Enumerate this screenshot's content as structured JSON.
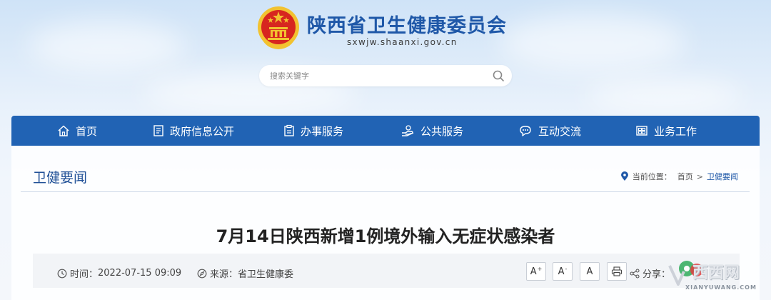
{
  "header": {
    "site_title": "陕西省卫生健康委员会",
    "site_url": "sxwjw.shaanxi.gov.cn",
    "search_placeholder": "搜索关键字"
  },
  "nav": {
    "items": [
      {
        "label": "首页",
        "icon": "home-icon"
      },
      {
        "label": "政府信息公开",
        "icon": "document-list-icon"
      },
      {
        "label": "办事服务",
        "icon": "clipboard-icon"
      },
      {
        "label": "公共服务",
        "icon": "hand-service-icon"
      },
      {
        "label": "互动交流",
        "icon": "chat-bubble-icon"
      },
      {
        "label": "业务工作",
        "icon": "briefcase-icon"
      }
    ]
  },
  "section": {
    "title": "卫健要闻",
    "location_label": "当前位置：",
    "crumbs": [
      "首页",
      "卫健要闻"
    ],
    "separator": ">"
  },
  "article": {
    "title": "7月14日陕西新增1例境外输入无症状感染者",
    "time_label": "时间：",
    "time_value": "2022-07-15 09:09",
    "source_label": "来源：",
    "source_value": "省卫生健康委",
    "font_larger": "A",
    "font_smaller": "A",
    "font_default": "A",
    "share_label": "分享："
  },
  "watermark": {
    "text": "西西网",
    "sub": "XIANYUWANG.COM"
  },
  "colors": {
    "brand_blue": "#2163b4",
    "title_blue": "#1f58a8",
    "emblem_red": "#d7261f",
    "emblem_gold": "#f2c230"
  }
}
